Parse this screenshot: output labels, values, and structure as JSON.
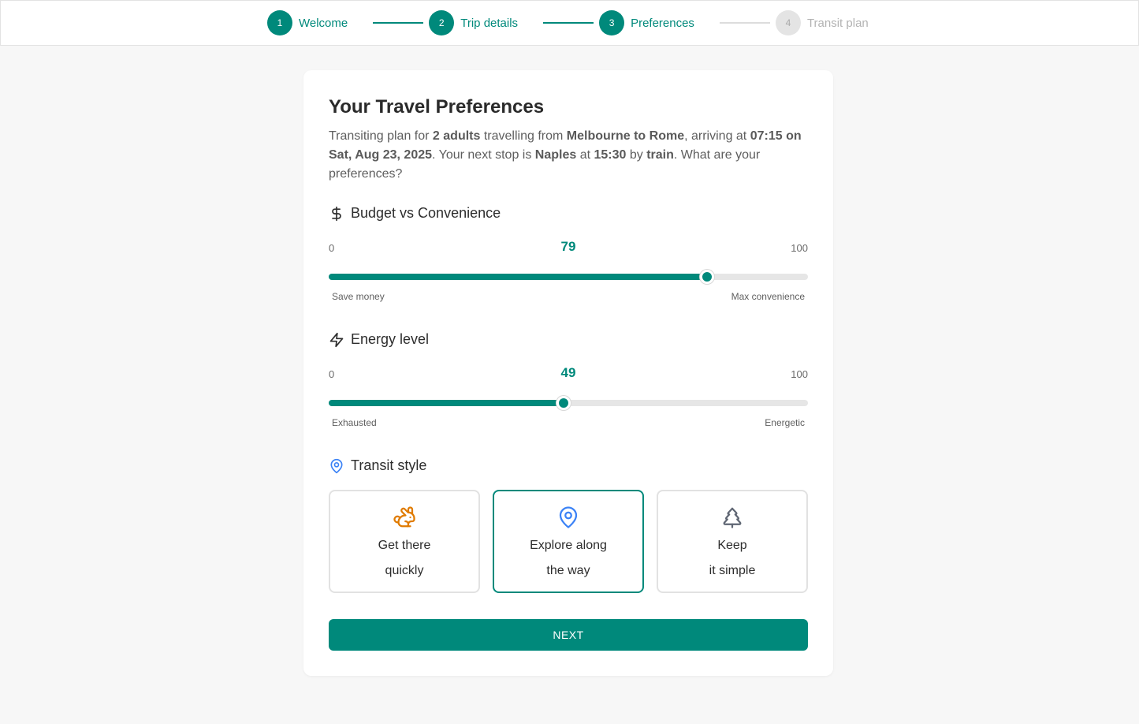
{
  "stepper": {
    "steps": [
      {
        "number": "1",
        "label": "Welcome",
        "state": "complete"
      },
      {
        "number": "2",
        "label": "Trip details",
        "state": "complete"
      },
      {
        "number": "3",
        "label": "Preferences",
        "state": "active"
      },
      {
        "number": "4",
        "label": "Transit plan",
        "state": "inactive"
      }
    ]
  },
  "card": {
    "title": "Your Travel Preferences",
    "intro": {
      "t1": "Transiting plan for ",
      "travellers": "2 adults",
      "t2": " travelling from ",
      "route": "Melbourne to Rome",
      "t3": ", arriving at ",
      "arrival": "07:15 on Sat, Aug 23, 2025",
      "t4": ". Your next stop is ",
      "next_stop": "Naples",
      "t5": " at ",
      "departure_time": "15:30",
      "t6": " by ",
      "mode": "train",
      "t7": ". What are your preferences?"
    }
  },
  "budget": {
    "icon": "dollar-icon",
    "label": "Budget vs Convenience",
    "min": "0",
    "max": "100",
    "value": 79,
    "value_text": "79",
    "left_caption": "Save money",
    "right_caption": "Max convenience"
  },
  "energy": {
    "icon": "lightning-icon",
    "label": "Energy level",
    "min": "0",
    "max": "100",
    "value": 49,
    "value_text": "49",
    "left_caption": "Exhausted",
    "right_caption": "Energetic"
  },
  "transit_style": {
    "icon": "map-pin-icon",
    "label": "Transit style",
    "options": [
      {
        "icon": "rabbit-icon",
        "line1": "Get there",
        "line2": "quickly",
        "selected": false
      },
      {
        "icon": "map-pin-icon",
        "line1": "Explore along",
        "line2": "the way",
        "selected": true
      },
      {
        "icon": "tree-icon",
        "line1": "Keep",
        "line2": "it simple",
        "selected": false
      }
    ]
  },
  "next_button": "NEXT",
  "colors": {
    "accent": "#00897b",
    "orange": "#e07b00",
    "blue": "#3b82f6"
  }
}
